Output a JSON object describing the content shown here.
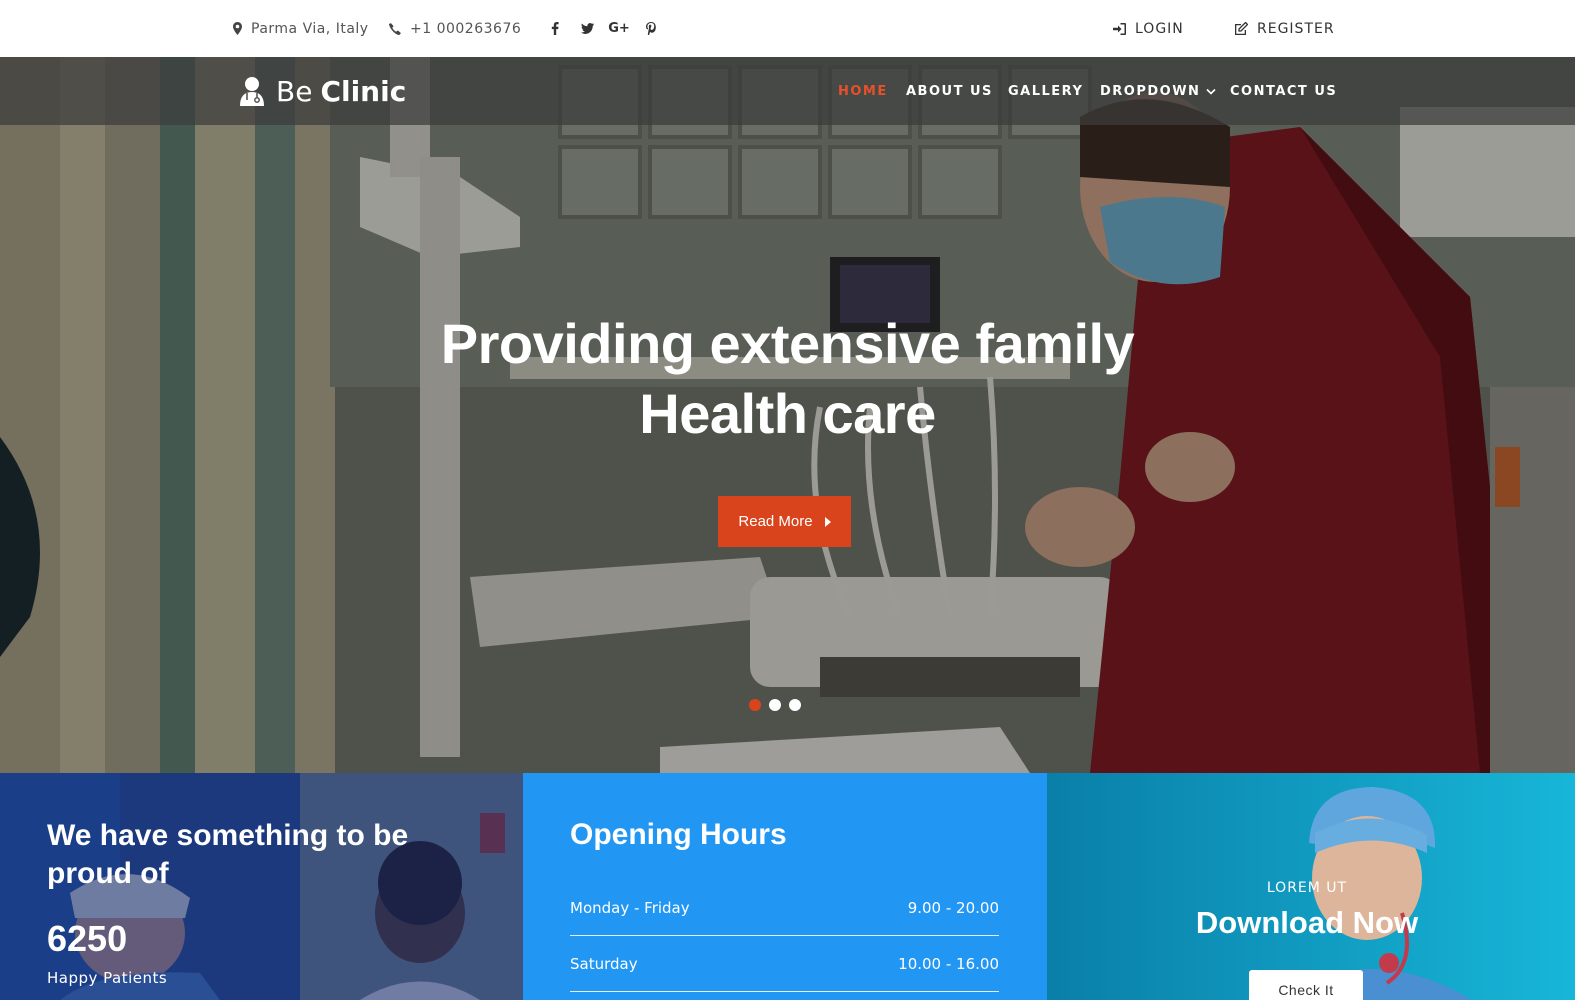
{
  "topbar": {
    "location": "Parma Via, Italy",
    "phone": "+1 000263676",
    "social": [
      {
        "name": "facebook-icon",
        "glyph": "f"
      },
      {
        "name": "twitter-icon",
        "glyph": "t"
      },
      {
        "name": "google-plus-icon",
        "glyph": "G+"
      },
      {
        "name": "pinterest-icon",
        "glyph": "p"
      }
    ],
    "login": "LOGIN",
    "register": "REGISTER"
  },
  "navbar": {
    "logo_light": "Be",
    "logo_bold": "Clinic",
    "items": [
      {
        "label": "HOME",
        "active": true
      },
      {
        "label": "ABOUT US",
        "active": false
      },
      {
        "label": "GALLERY",
        "active": false
      },
      {
        "label": "DROPDOWN",
        "active": false
      },
      {
        "label": "CONTACT US",
        "active": false
      }
    ]
  },
  "hero": {
    "title_line1": "Providing extensive family",
    "title_line2": "Health care",
    "button": "Read More",
    "slide_count": 3,
    "active_slide": 0
  },
  "stats": {
    "title": "We have something to be proud of",
    "number": "6250",
    "label": "Happy Patients"
  },
  "hours": {
    "title": "Opening Hours",
    "rows": [
      {
        "day": "Monday - Friday",
        "time": "9.00 - 20.00"
      },
      {
        "day": "Saturday",
        "time": "10.00 - 16.00"
      }
    ]
  },
  "download": {
    "subtitle": "LOREM UT",
    "title": "Download Now",
    "button": "Check It"
  },
  "colors": {
    "accent": "#d9441c",
    "hours_bg": "#2196f3",
    "download_bg": "#0fa2c9"
  }
}
